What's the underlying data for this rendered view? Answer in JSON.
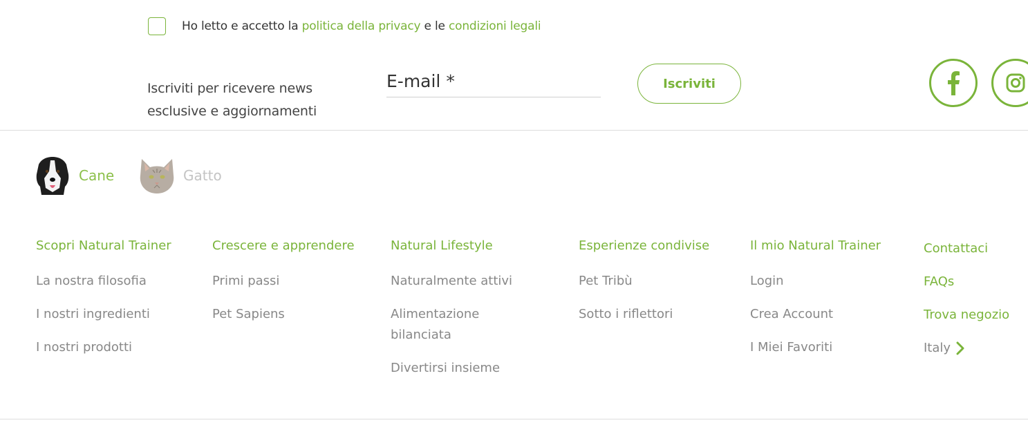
{
  "consent": {
    "text_before": "Ho letto e accetto la ",
    "privacy_link": "politica della privacy",
    "text_middle": " e le ",
    "legal_link": "condizioni legali"
  },
  "newsletter": {
    "label_line1": "Iscriviti per ricevere news",
    "label_line2": "esclusive e aggiornamenti",
    "email_placeholder": "E-mail *",
    "subscribe_label": "Iscriviti"
  },
  "social": [
    {
      "name": "facebook-icon"
    },
    {
      "name": "instagram-icon"
    }
  ],
  "pets": [
    {
      "label": "Cane",
      "icon": "dog-icon",
      "active": true
    },
    {
      "label": "Gatto",
      "icon": "cat-icon",
      "active": false
    }
  ],
  "columns": [
    {
      "title": "Scopri Natural Trainer",
      "links": [
        "La nostra filosofia",
        "I nostri ingredienti",
        "I nostri prodotti"
      ]
    },
    {
      "title": "Crescere e apprendere",
      "links": [
        "Primi passi",
        "Pet Sapiens"
      ]
    },
    {
      "title": "Natural Lifestyle",
      "links": [
        "Naturalmente attivi",
        "Alimentazione bilanciata",
        "Divertirsi insieme"
      ]
    },
    {
      "title": "Esperienze condivise",
      "links": [
        "Pet Tribù",
        "Sotto i riflettori"
      ]
    },
    {
      "title": "Il mio Natural Trainer",
      "links": [
        "Login",
        "Crea Account",
        "I Miei Favoriti"
      ]
    }
  ],
  "contact": {
    "links": [
      "Contattaci",
      "FAQs",
      "Trova negozio"
    ],
    "country": "Italy"
  },
  "colors": {
    "accent": "#7ab43a",
    "muted_text": "#888888",
    "inactive": "#c4c4c4"
  }
}
